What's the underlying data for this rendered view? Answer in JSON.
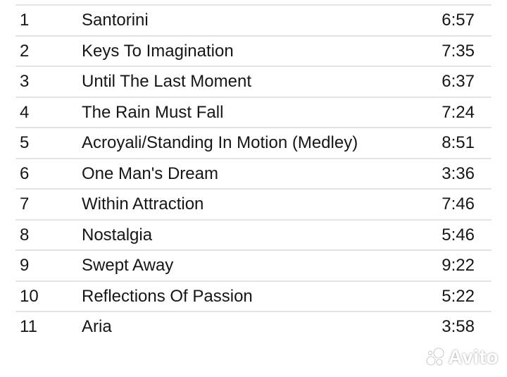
{
  "tracklist": {
    "tracks": [
      {
        "number": "1",
        "title": "Santorini",
        "duration": "6:57"
      },
      {
        "number": "2",
        "title": "Keys To Imagination",
        "duration": "7:35"
      },
      {
        "number": "3",
        "title": "Until The Last Moment",
        "duration": "6:37"
      },
      {
        "number": "4",
        "title": "The Rain Must Fall",
        "duration": "7:24"
      },
      {
        "number": "5",
        "title": "Acroyali/Standing In Motion (Medley)",
        "duration": "8:51"
      },
      {
        "number": "6",
        "title": "One Man's Dream",
        "duration": "3:36"
      },
      {
        "number": "7",
        "title": "Within Attraction",
        "duration": "7:46"
      },
      {
        "number": "8",
        "title": "Nostalgia",
        "duration": "5:46"
      },
      {
        "number": "9",
        "title": "Swept Away",
        "duration": "9:22"
      },
      {
        "number": "10",
        "title": "Reflections Of Passion",
        "duration": "5:22"
      },
      {
        "number": "11",
        "title": "Aria",
        "duration": "3:58"
      }
    ]
  },
  "watermark": {
    "text": "Avito",
    "icon": "avito-logo-icon"
  },
  "colors": {
    "text": "#161616",
    "divider": "#e4e4e4",
    "background": "#ffffff"
  }
}
